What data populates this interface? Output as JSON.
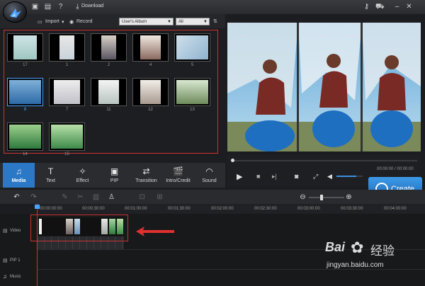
{
  "titlebar": {
    "download_label": "Download"
  },
  "media_toolbar": {
    "import_label": "Import",
    "record_label": "Record",
    "album_select": "User's Album",
    "filter_select": "All"
  },
  "media_items": [
    {
      "label": "17"
    },
    {
      "label": "1"
    },
    {
      "label": "2"
    },
    {
      "label": "4"
    },
    {
      "label": "5"
    },
    {
      "label": "8"
    },
    {
      "label": "7"
    },
    {
      "label": "11"
    },
    {
      "label": "12"
    },
    {
      "label": "13"
    },
    {
      "label": "14"
    },
    {
      "label": "15"
    }
  ],
  "tabs": [
    {
      "label": "Media",
      "icon": "media-icon"
    },
    {
      "label": "Text",
      "icon": "text-icon"
    },
    {
      "label": "Effect",
      "icon": "effect-icon"
    },
    {
      "label": "PIP",
      "icon": "pip-icon"
    },
    {
      "label": "Transition",
      "icon": "transition-icon"
    },
    {
      "label": "Intro/Credit",
      "icon": "intro-credit-icon"
    },
    {
      "label": "Sound",
      "icon": "sound-icon"
    }
  ],
  "player": {
    "time": "00:00:00 / 00:00:00",
    "volume": 0.75
  },
  "create_label": "Create",
  "timeline": {
    "ticks": [
      "00:00:00:00",
      "00:00:30:00",
      "00:01:00:00",
      "00:01:30:00",
      "00:02:00:00",
      "00:02:30:00",
      "00:03:00:00",
      "00:03:30:00",
      "00:04:00:00"
    ],
    "tracks": [
      {
        "label": "Video"
      },
      {
        "label": "PIP 1"
      },
      {
        "label": "Music"
      }
    ]
  },
  "watermark": {
    "brand": "Bai",
    "brand2": "经验",
    "url": "jingyan.baidu.com"
  },
  "colors": {
    "accent": "#2a78c6",
    "highlight": "#cc3333",
    "create": "#2f86d8"
  }
}
